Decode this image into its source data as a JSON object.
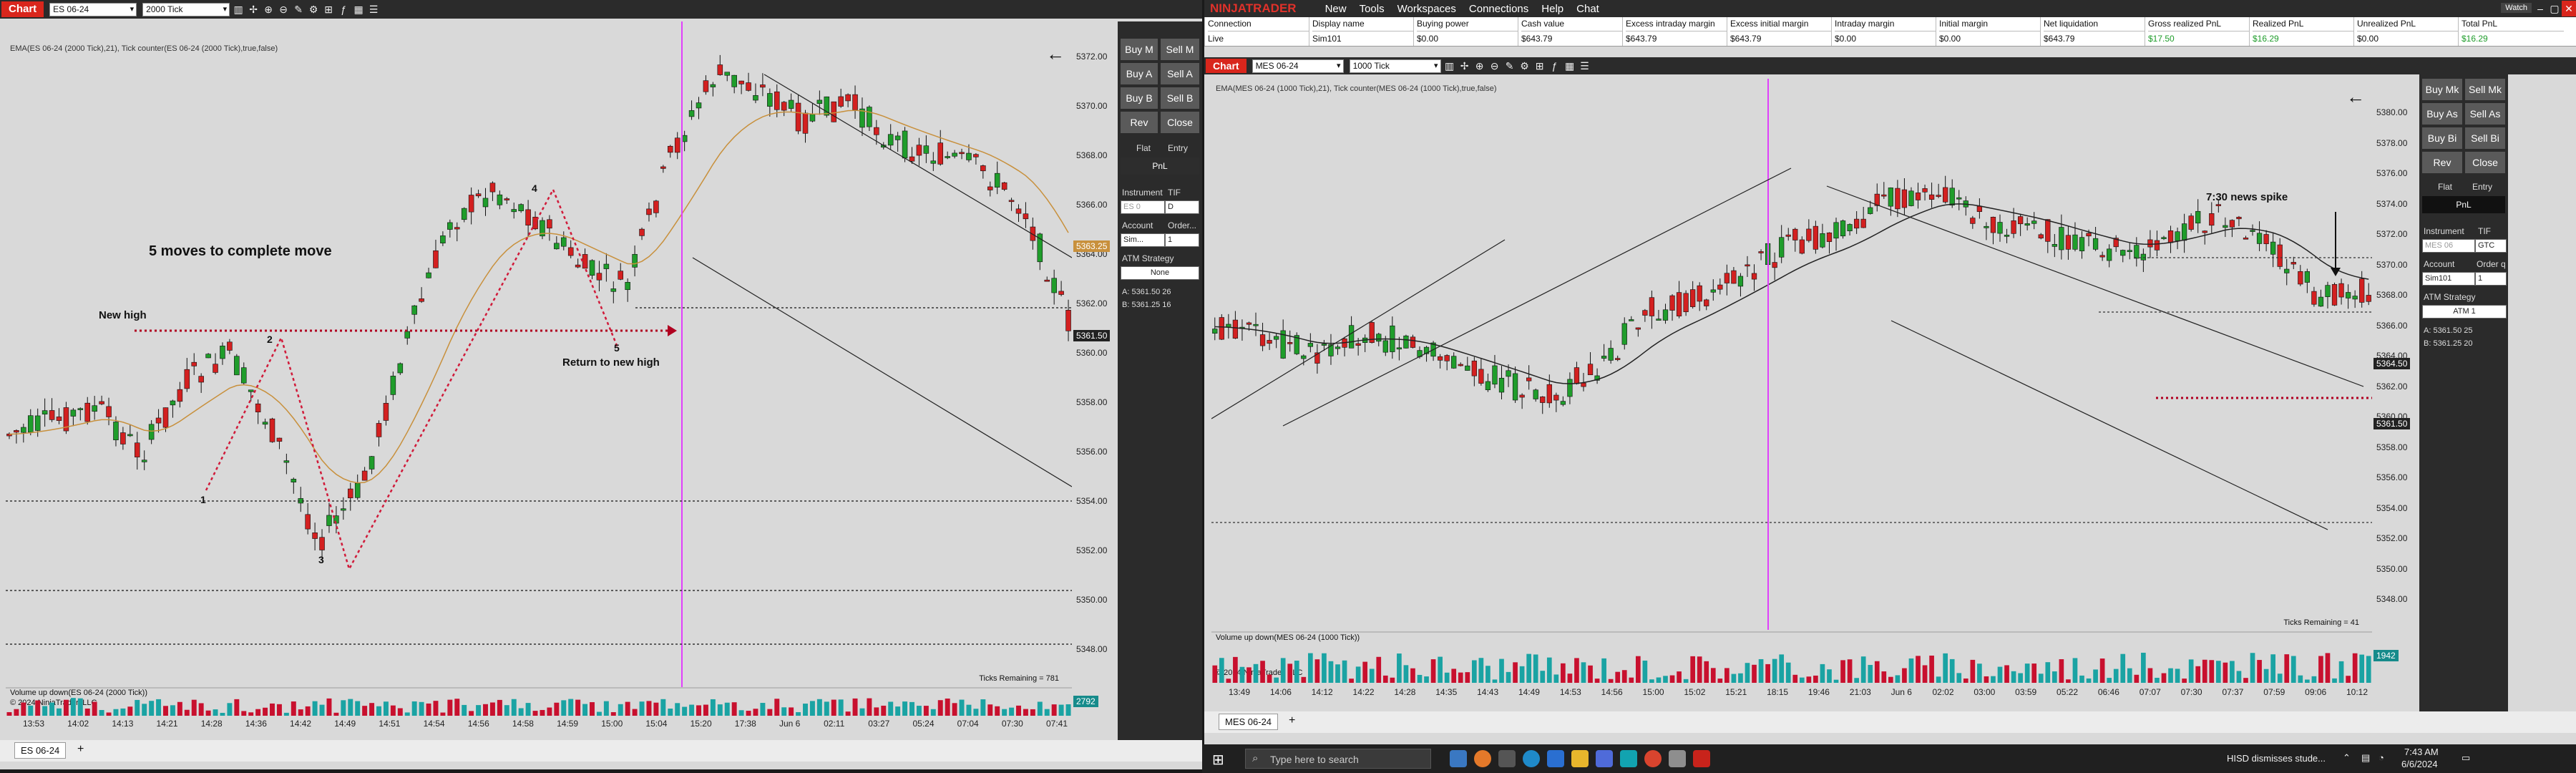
{
  "left": {
    "chip": "Chart",
    "instrument": "ES 06-24",
    "interval": "2000 Tick",
    "indicators": "EMA(ES 06-24 (2000 Tick),21), Tick counter(ES 06-24 (2000 Tick),true,false)",
    "annotations": {
      "title": "5 moves to complete move",
      "new_high": "New high",
      "return": "Return to new high",
      "n1": "1",
      "n2": "2",
      "n3": "3",
      "n4": "4",
      "n5": "5"
    },
    "price_axis": [
      "5372.00",
      "5370.00",
      "5368.00",
      "5366.00",
      "5364.00",
      "5362.00",
      "5360.00",
      "5358.00",
      "5356.00",
      "5354.00",
      "5352.00",
      "5350.00",
      "5348.00"
    ],
    "price_tags": {
      "ema": "5363.25",
      "last": "5361.50",
      "vol": "2792"
    },
    "time_axis": [
      "13:53",
      "14:02",
      "14:13",
      "14:21",
      "14:28",
      "14:36",
      "14:42",
      "14:49",
      "14:51",
      "14:54",
      "14:56",
      "14:58",
      "14:59",
      "15:00",
      "15:04",
      "15:20",
      "17:38",
      "Jun 6",
      "02:11",
      "03:27",
      "05:24",
      "07:04",
      "07:30",
      "07:41"
    ],
    "ticks_remaining": "Ticks Remaining = 781",
    "volume_label": "Volume up down(ES 06-24 (2000 Tick))",
    "copyright": "© 2024 NinjaTrader, LLC",
    "tab": "ES 06-24",
    "side": {
      "buy_mkt": "Buy M",
      "sell_mkt": "Sell M",
      "buy_ask": "Buy A",
      "sell_ask": "Sell A",
      "buy_bid": "Buy B",
      "sell_bid": "Sell B",
      "rev": "Rev",
      "close": "Close",
      "flat": "Flat",
      "entry": "Entry",
      "pnl": "PnL",
      "instrument_lbl": "Instrument",
      "tif_lbl": "TIF",
      "instrument_val": "ES 0",
      "tif_val": "D",
      "account_lbl": "Account",
      "order_lbl": "Order...",
      "account_val": "Sim...",
      "qty_val": "1",
      "atm_lbl": "ATM Strategy",
      "atm_val": "None",
      "ask": "A:  5361.50  26",
      "bid": "B:  5361.25  16"
    }
  },
  "right": {
    "brand": "NINJATRADER",
    "menu": [
      "New",
      "Tools",
      "Workspaces",
      "Connections",
      "Help",
      "Chat"
    ],
    "watch": "Watch",
    "account_table": {
      "headers": [
        "Connection",
        "Display name",
        "Buying power",
        "Cash value",
        "Excess intraday margin",
        "Excess initial margin",
        "Intraday margin",
        "Initial margin",
        "Net liquidation",
        "Gross realized PnL",
        "Realized PnL",
        "Unrealized PnL",
        "Total PnL"
      ],
      "values": [
        "Live",
        "Sim101",
        "$0.00",
        "$643.79",
        "$643.79",
        "$643.79",
        "$0.00",
        "$0.00",
        "$643.79",
        "$17.50",
        "$16.29",
        "$0.00",
        "$16.29"
      ]
    },
    "chip": "Chart",
    "instrument": "MES 06-24",
    "interval": "1000 Tick",
    "indicators": "EMA(MES 06-24 (1000 Tick),21), Tick counter(MES 06-24 (1000 Tick),true,false)",
    "annotations": {
      "spike": "7:30 news spike"
    },
    "price_axis": [
      "5380.00",
      "5378.00",
      "5376.00",
      "5374.00",
      "5372.00",
      "5370.00",
      "5368.00",
      "5366.00",
      "5364.00",
      "5362.00",
      "5360.00",
      "5358.00",
      "5356.00",
      "5354.00",
      "5352.00",
      "5350.00",
      "5348.00"
    ],
    "price_tags": {
      "ema": "5364.50",
      "last": "5361.50",
      "vol": "1942"
    },
    "time_axis": [
      "13:49",
      "14:06",
      "14:12",
      "14:22",
      "14:28",
      "14:35",
      "14:43",
      "14:49",
      "14:53",
      "14:56",
      "15:00",
      "15:02",
      "15:21",
      "18:15",
      "19:46",
      "21:03",
      "Jun 6",
      "02:02",
      "03:00",
      "03:59",
      "05:22",
      "06:46",
      "07:07",
      "07:30",
      "07:37",
      "07:59",
      "09:06",
      "10:12"
    ],
    "ticks_remaining": "Ticks Remaining = 41",
    "volume_label": "Volume up down(MES 06-24 (1000 Tick))",
    "copyright": "© 2024 NinjaTrader, LLC",
    "tab": "MES 06-24",
    "side": {
      "buy_mkt": "Buy Mk",
      "sell_mkt": "Sell Mk",
      "buy_ask": "Buy As",
      "sell_ask": "Sell As",
      "buy_bid": "Buy Bi",
      "sell_bid": "Sell Bi",
      "rev": "Rev",
      "close": "Close",
      "flat": "Flat",
      "entry": "Entry",
      "pnl": "PnL",
      "instrument_lbl": "Instrument",
      "tif_lbl": "TIF",
      "instrument_val": "MES 06",
      "tif_val": "GTC",
      "account_lbl": "Account",
      "order_lbl": "Order q",
      "account_val": "Sim101",
      "qty_val": "1",
      "atm_lbl": "ATM Strategy",
      "atm_val": "ATM 1",
      "ask": "A:  5361.50    25",
      "bid": "B:  5361.25    20"
    }
  },
  "taskbar": {
    "search_placeholder": "Type here to search",
    "news": "HISD dismisses stude...",
    "time": "7:43 AM",
    "date": "6/6/2024"
  },
  "colors": {
    "up": "#1f9d2b",
    "down": "#d32020",
    "accent": "#d9261c",
    "bg": "#d9d9d9",
    "ema_left": "#c8903c",
    "ema_right": "#222222"
  }
}
